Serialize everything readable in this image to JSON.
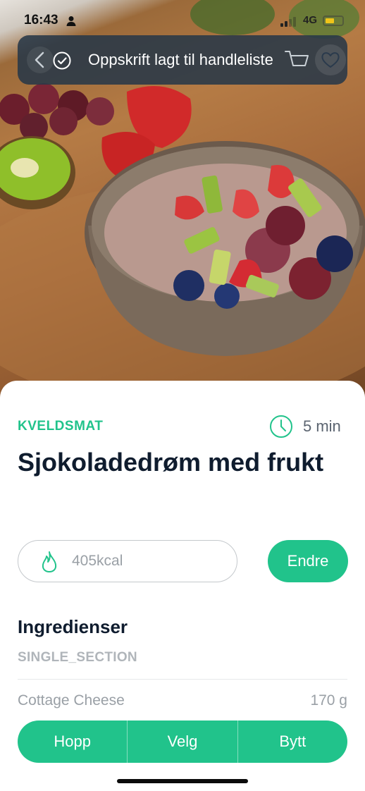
{
  "status_bar": {
    "time": "16:43",
    "network": "4G",
    "battery_level": 0.4,
    "battery_color": "#f0c419"
  },
  "toast": {
    "message": "Oppskrift lagt til handleliste",
    "icon": "check-circle-icon"
  },
  "header_actions": {
    "back_icon": "back-arrow-icon",
    "cart_icon": "cart-icon",
    "favorite_icon": "heart-icon"
  },
  "recipe": {
    "category": "KVELDSMAT",
    "duration": "5 min",
    "title": "Sjokoladedrøm med frukt",
    "calories": "405kcal",
    "edit_label": "Endre"
  },
  "ingredients": {
    "heading": "Ingredienser",
    "section": "SINGLE_SECTION",
    "items": [
      {
        "name": "Cottage Cheese",
        "amount": "170 g"
      }
    ]
  },
  "actions": {
    "skip": "Hopp",
    "choose": "Velg",
    "swap": "Bytt"
  },
  "colors": {
    "accent": "#21c38b",
    "title": "#0f1c2e",
    "toast_bg": "#283848"
  }
}
